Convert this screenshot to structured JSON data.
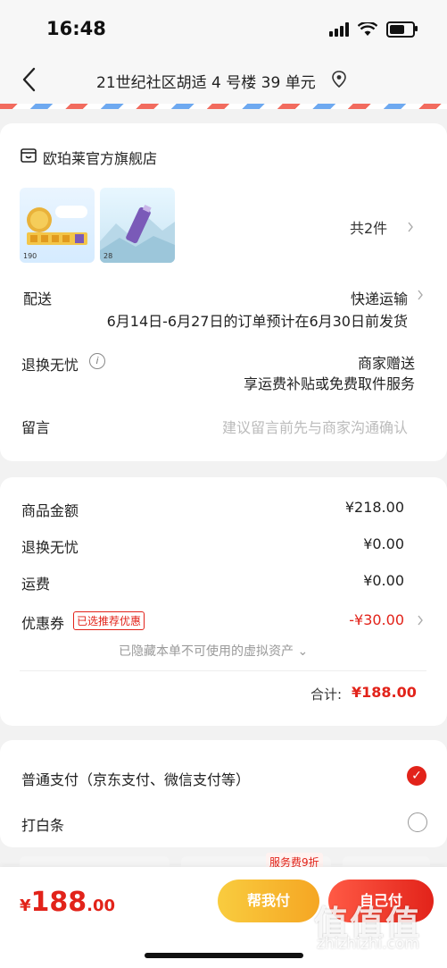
{
  "status_bar": {
    "time": "16:48"
  },
  "header": {
    "address": "21世纪社区胡适 4 号楼 39 单元"
  },
  "store": {
    "name": "欧珀莱官方旗舰店",
    "item_count": "共2件",
    "products": [
      {
        "thumb_label": "190"
      },
      {
        "thumb_label": "28"
      }
    ]
  },
  "delivery": {
    "label": "配送",
    "method": "快递运输",
    "eta": "6月14日-6月27日的订单预计在6月30日前发货"
  },
  "return_service": {
    "label": "退换无忧",
    "value": "商家赠送",
    "desc": "享运费补贴或免费取件服务"
  },
  "message": {
    "label": "留言",
    "placeholder": "建议留言前先与商家沟通确认"
  },
  "summary": {
    "goods_label": "商品金额",
    "goods_value": "¥218.00",
    "return_label": "退换无忧",
    "return_value": "¥0.00",
    "shipping_label": "运费",
    "shipping_value": "¥0.00",
    "coupon_label": "优惠券",
    "coupon_tag": "已选推荐优惠",
    "coupon_value": "-¥30.00",
    "hidden_assets": "已隐藏本单不可使用的虚拟资产 ⌄",
    "total_label": "合计:",
    "total_value": "¥188.00"
  },
  "payment": {
    "option_normal": "普通支付（京东支付、微信支付等）",
    "option_baitiao": "打白条",
    "fee_badge": "服务费9折"
  },
  "bottom": {
    "price_currency": "¥",
    "price_int": "188",
    "price_dec": ".00",
    "friend_pay": "帮我付",
    "self_pay": "自己付"
  },
  "watermark": {
    "text": "值值值",
    "url": "zhizhizhi.com"
  },
  "colors": {
    "accent": "#e2231a",
    "friend_btn": "#f5a623"
  }
}
